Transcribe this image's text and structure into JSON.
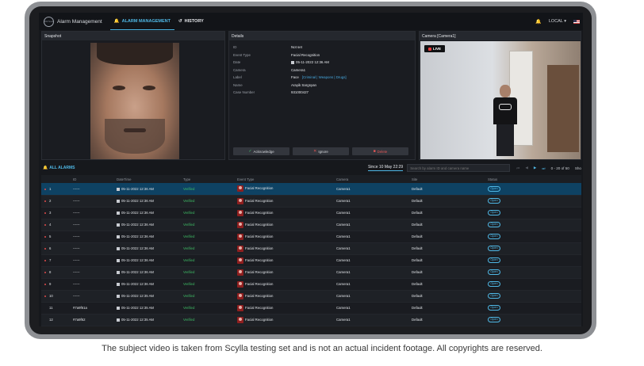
{
  "app": {
    "logo_text": "SCYLLA",
    "title": "Alarm Management",
    "nav": [
      {
        "label": "ALARM MANAGEMENT",
        "icon": "bell-icon"
      },
      {
        "label": "HISTORY",
        "icon": "history-icon"
      }
    ],
    "locale": "LOCAL"
  },
  "snapshot": {
    "header": "Snapshot"
  },
  "details": {
    "header": "Details",
    "fields": [
      {
        "label": "ID",
        "value": "Not set"
      },
      {
        "label": "Event Type",
        "value": "Facial Recognition"
      },
      {
        "label": "Date",
        "value": "05-11-2022 12:36 AM"
      },
      {
        "label": "Camera",
        "value": "Camera1"
      },
      {
        "label": "Label",
        "value": "Face",
        "tags": "[Criminal | Weapons | Drugs]"
      },
      {
        "label": "Name",
        "value": "Arayik Sargsyan"
      },
      {
        "label": "Case Number",
        "value": "931000427"
      }
    ],
    "actions": {
      "acknowledge": "Acknowledge",
      "ignore": "Ignore",
      "delete": "Delete"
    }
  },
  "camera": {
    "header": "Camera [Camera1]",
    "live": "LIVE"
  },
  "alarms": {
    "title": "ALL ALARMS",
    "since": "Since 10 May 22:29",
    "search_placeholder": "Search by alarm ID and camera name",
    "pagination": "0 - 20 of 50",
    "sort_label": "Sho",
    "columns": [
      "ID",
      "DateTime",
      "Type",
      "Event Type",
      "Camera",
      "Site",
      "Status"
    ],
    "rows": [
      {
        "num": "1",
        "id": "------",
        "datetime": "05-11-2022 12:36 AM",
        "type": "Verified",
        "event": "Facial Recognition",
        "camera": "Camera1",
        "site": "Default",
        "status": "Open",
        "new": true
      },
      {
        "num": "2",
        "id": "------",
        "datetime": "05-11-2022 12:36 AM",
        "type": "Verified",
        "event": "Facial Recognition",
        "camera": "Camera1",
        "site": "Default",
        "status": "Open",
        "new": true
      },
      {
        "num": "3",
        "id": "------",
        "datetime": "05-11-2022 12:36 AM",
        "type": "Verified",
        "event": "Facial Recognition",
        "camera": "Camera1",
        "site": "Default",
        "status": "Open",
        "new": true
      },
      {
        "num": "4",
        "id": "------",
        "datetime": "05-11-2022 12:36 AM",
        "type": "Verified",
        "event": "Facial Recognition",
        "camera": "Camera1",
        "site": "Default",
        "status": "Open",
        "new": true
      },
      {
        "num": "5",
        "id": "------",
        "datetime": "05-11-2022 12:36 AM",
        "type": "Verified",
        "event": "Facial Recognition",
        "camera": "Camera1",
        "site": "Default",
        "status": "Open",
        "new": true
      },
      {
        "num": "6",
        "id": "------",
        "datetime": "05-11-2022 12:36 AM",
        "type": "Verified",
        "event": "Facial Recognition",
        "camera": "Camera1",
        "site": "Default",
        "status": "Open",
        "new": true
      },
      {
        "num": "7",
        "id": "------",
        "datetime": "05-11-2022 12:36 AM",
        "type": "Verified",
        "event": "Facial Recognition",
        "camera": "Camera1",
        "site": "Default",
        "status": "Open",
        "new": true
      },
      {
        "num": "8",
        "id": "------",
        "datetime": "05-11-2022 12:36 AM",
        "type": "Verified",
        "event": "Facial Recognition",
        "camera": "Camera1",
        "site": "Default",
        "status": "Open",
        "new": true
      },
      {
        "num": "9",
        "id": "------",
        "datetime": "05-11-2022 12:36 AM",
        "type": "Verified",
        "event": "Facial Recognition",
        "camera": "Camera1",
        "site": "Default",
        "status": "Open",
        "new": true
      },
      {
        "num": "10",
        "id": "------",
        "datetime": "05-11-2022 12:35 AM",
        "type": "Verified",
        "event": "Facial Recognition",
        "camera": "Camera1",
        "site": "Default",
        "status": "Open",
        "new": true
      },
      {
        "num": "11",
        "id": "#7a9f61a",
        "datetime": "05-11-2022 12:35 AM",
        "type": "Verified",
        "event": "Facial Recognition",
        "camera": "Camera1",
        "site": "Default",
        "status": "Open",
        "new": false
      },
      {
        "num": "12",
        "id": "#7a9f62",
        "datetime": "05-11-2022 12:35 AM",
        "type": "Verified",
        "event": "Facial Recognition",
        "camera": "Camera1",
        "site": "Default",
        "status": "Open",
        "new": false
      }
    ]
  },
  "caption": "The subject video is taken from Scylla testing set and is not an actual incident footage. All copyrights are reserved.",
  "colors": {
    "accent": "#4fb8e6",
    "verified": "#3fbe66",
    "alert": "#e14b4b",
    "selected_row": "#0e4263"
  }
}
